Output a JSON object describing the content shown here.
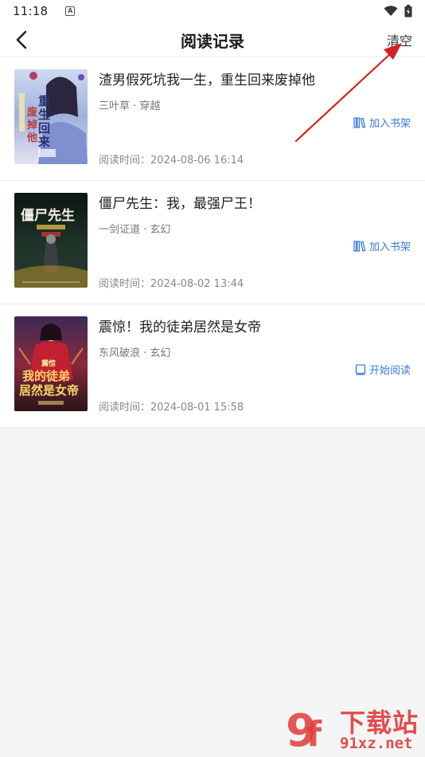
{
  "status": {
    "time": "11:18",
    "indicator": "A"
  },
  "header": {
    "title": "阅读记录",
    "clear_label": "清空"
  },
  "books": [
    {
      "title": "渣男假死坑我一生，重生回来废掉他",
      "meta": "三叶草 · 穿越",
      "read_time": "阅读时间：2024-08-06 16:14",
      "action": "加入书架",
      "action_icon": "bookshelf-add-icon",
      "cover_text": "重生回来废掉他"
    },
    {
      "title": "僵尸先生：我，最强尸王！",
      "meta": "一剑证道 · 玄幻",
      "read_time": "阅读时间：2024-08-02 13:44",
      "action": "加入书架",
      "action_icon": "bookshelf-add-icon",
      "cover_text": "僵尸先生"
    },
    {
      "title": "震惊！我的徒弟居然是女帝",
      "meta": "东风破浪 · 玄幻",
      "read_time": "阅读时间：2024-08-01 15:58",
      "action": "开始阅读",
      "action_icon": "book-read-icon",
      "cover_text": "我的徒弟居然是女帝"
    }
  ],
  "watermark": {
    "brand": "下载站",
    "domain": "91xz.net"
  },
  "colors": {
    "accent": "#3a7be0",
    "arrow": "#d42020",
    "watermark": "#e23b3b"
  }
}
